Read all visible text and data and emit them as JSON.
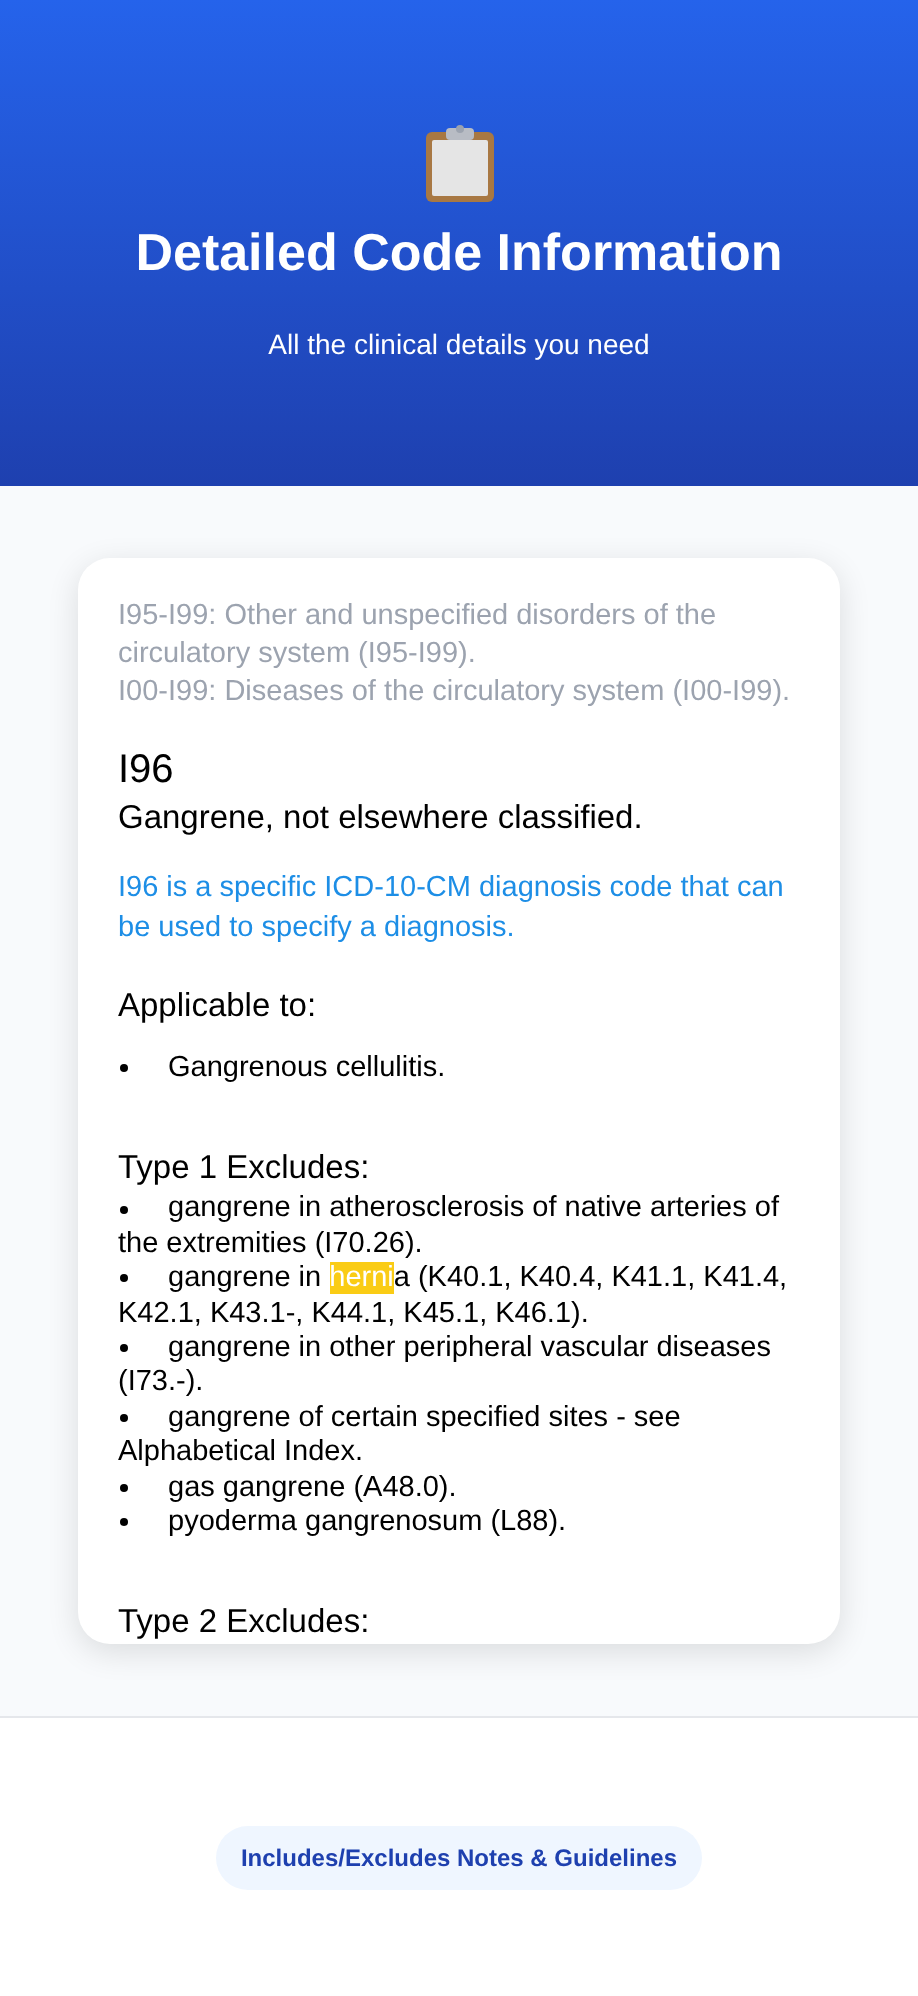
{
  "header": {
    "title": "Detailed Code Information",
    "subtitle": "All the clinical details you need"
  },
  "card": {
    "hierarchy": [
      "I95-I99: Other and unspecified disorders of the circulatory system (I95-I99).",
      "I00-I99: Diseases of the circulatory system (I00-I99)."
    ],
    "code": "I96",
    "description": "Gangrene, not elsewhere classified.",
    "note": "I96 is a specific ICD-10-CM diagnosis code that can be used to specify a diagnosis.",
    "sections": [
      {
        "heading": "Applicable to:",
        "items": [
          {
            "before": "Gangrenous cellulitis."
          }
        ]
      },
      {
        "heading": "Type 1 Excludes:",
        "items": [
          {
            "before": "gangrene in atherosclerosis of native arteries of the extremities (I70.26)."
          },
          {
            "before": "gangrene in ",
            "highlighted": "herni",
            "after": "a (K40.1, K40.4, K41.1, K41.4, K42.1, K43.1-, K44.1, K45.1, K46.1)."
          },
          {
            "before": "gangrene in other peripheral vascular diseases (I73.-)."
          },
          {
            "before": "gangrene of certain specified sites - see Alphabetical Index."
          },
          {
            "before": "gas gangrene (A48.0)."
          },
          {
            "before": "pyoderma gangrenosum (L88)."
          }
        ]
      },
      {
        "heading": "Type 2 Excludes:"
      }
    ]
  },
  "footer": {
    "button": "Includes/Excludes Notes & Guidelines"
  }
}
